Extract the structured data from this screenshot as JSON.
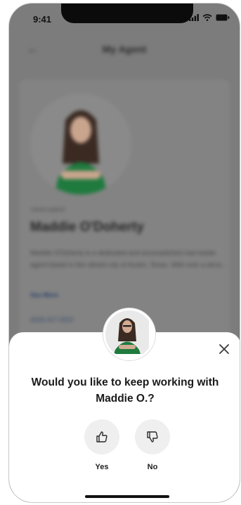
{
  "status_bar": {
    "time": "9:41"
  },
  "header": {
    "title": "My Agent"
  },
  "agent": {
    "section_label": "YOUR AGENT",
    "name": "Maddie O'Doherty",
    "bio": "Maddie O'Doherty is a dedicated and accomplished real estate agent based in the vibrant city of Austin, Texas. With over a deca...",
    "see_more": "See More",
    "phone": "(619) 417-3222"
  },
  "prompt": {
    "question": "Would you like to keep working with Maddie O.?",
    "yes_label": "Yes",
    "no_label": "No"
  },
  "colors": {
    "overlay": "#7c7c7c",
    "sheet_bg": "#ffffff",
    "vote_button_bg": "#efefef",
    "agent_shirt": "#1f7a3e"
  },
  "icons": {
    "back": "arrow-left-icon",
    "close": "close-icon",
    "yes": "thumbs-up-icon",
    "no": "thumbs-down-icon"
  }
}
